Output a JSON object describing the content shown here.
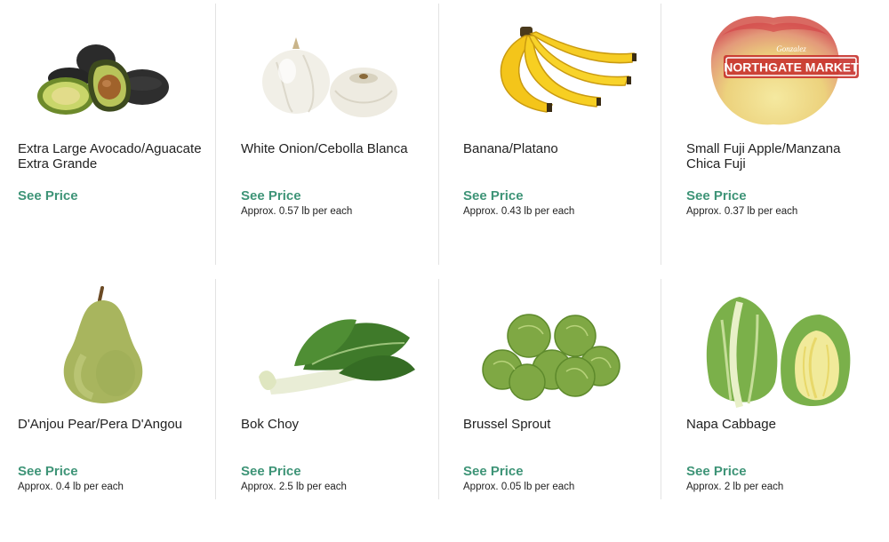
{
  "watermark": "NORTHGATE MARKET",
  "watermark_script": "Gonzalez",
  "colors": {
    "price_link": "#3e9477",
    "divider": "#e3e3e3"
  },
  "products": [
    {
      "name": "Extra Large Avocado/Aguacate Extra Grande",
      "price_label": "See Price",
      "approx": "",
      "icon": "avocado-image"
    },
    {
      "name": "White Onion/Cebolla Blanca",
      "price_label": "See Price",
      "approx": "Approx. 0.57 lb per each",
      "icon": "onion-image"
    },
    {
      "name": "Banana/Platano",
      "price_label": "See Price",
      "approx": "Approx. 0.43 lb per each",
      "icon": "banana-image"
    },
    {
      "name": "Small Fuji Apple/Manzana Chica Fuji",
      "price_label": "See Price",
      "approx": "Approx. 0.37 lb per each",
      "icon": "apple-image"
    },
    {
      "name": "D'Anjou Pear/Pera D'Angou",
      "price_label": "See Price",
      "approx": "Approx. 0.4 lb per each",
      "icon": "pear-image"
    },
    {
      "name": "Bok Choy",
      "price_label": "See Price",
      "approx": "Approx. 2.5 lb per each",
      "icon": "bok-choy-image"
    },
    {
      "name": "Brussel Sprout",
      "price_label": "See Price",
      "approx": "Approx. 0.05 lb per each",
      "icon": "brussel-sprout-image"
    },
    {
      "name": "Napa Cabbage",
      "price_label": "See Price",
      "approx": "Approx. 2 lb per each",
      "icon": "napa-cabbage-image"
    }
  ]
}
